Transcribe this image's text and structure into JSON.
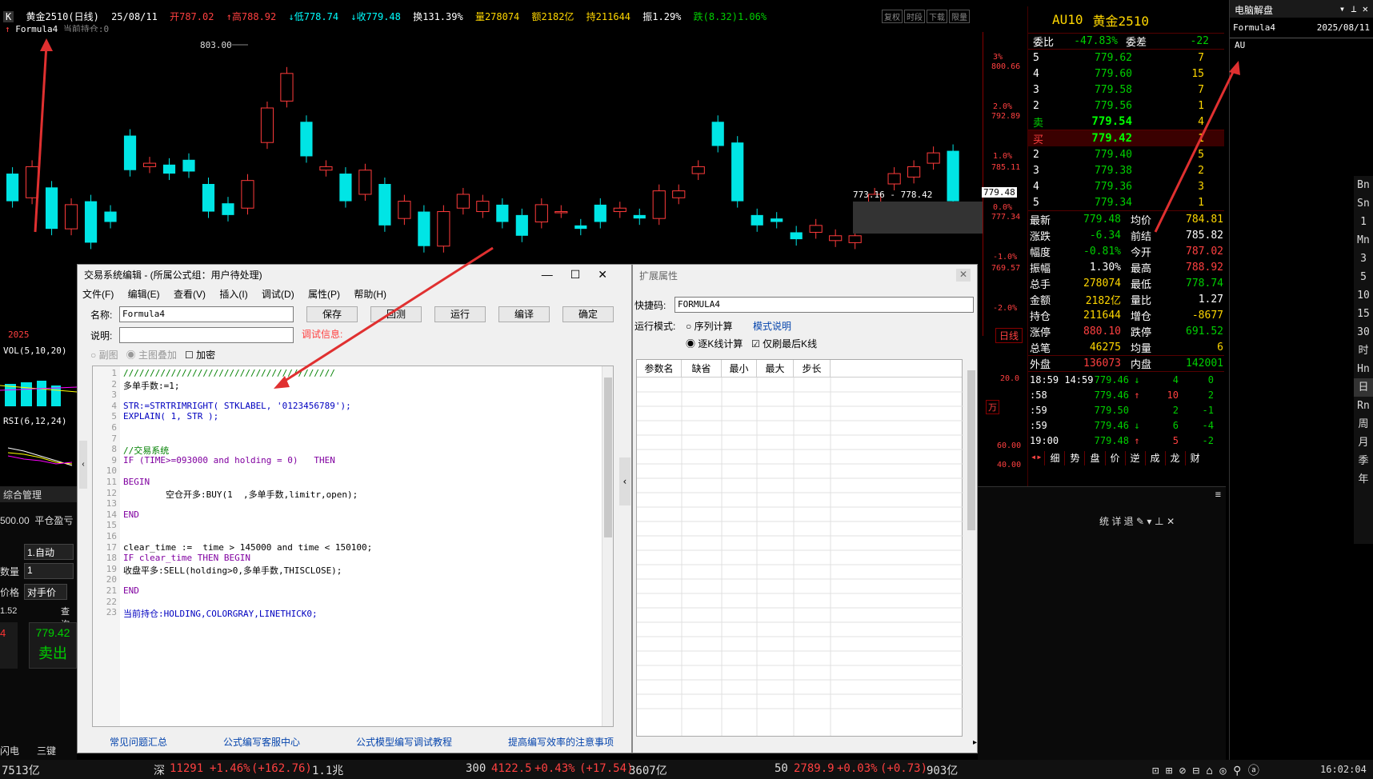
{
  "topbar": {
    "icon_label": "K",
    "symbol": "黄金2510(日线)",
    "date": "25/08/11",
    "open": "开787.02",
    "high": "↑高788.92",
    "low": "↓低778.74",
    "close": "↓收779.48",
    "turnover": "换131.39%",
    "volume": "量278074",
    "amount": "额2182亿",
    "hold": "持211644",
    "amplitude": "振1.29%",
    "change": "跌(8.32)1.06%",
    "buttons": [
      "复权",
      "时段",
      "下载",
      "限量"
    ],
    "formula": "Formula4",
    "position": "当前持仓:0"
  },
  "chart": {
    "peak_label": "803.00",
    "range_label": "773.16 - 778.42",
    "price_tag": "779.48",
    "axis_right": [
      "800.66",
      "792.89",
      "785.11",
      "777.34",
      "769.57"
    ],
    "pct_axis": [
      "3%",
      "2.0%",
      "1.0%",
      "0.0%",
      "-1.0%",
      "-2.0%"
    ],
    "year": "2025",
    "vol_label": "VOL(5,10,20)",
    "rsi_label": "RSI(6,12,24)",
    "rsi_axis": [
      "20.0",
      "60.00",
      "40.00"
    ],
    "week_tab": "日线",
    "month_tab": "万",
    "candles": [
      {
        "o": 785.5,
        "c": 781.5
      },
      {
        "o": 782,
        "c": 786.5
      },
      {
        "o": 783.5,
        "c": 777.5
      },
      {
        "o": 777.5,
        "c": 781.0
      },
      {
        "o": 781.5,
        "c": 775.5
      },
      {
        "o": 780.0,
        "c": 778.5
      },
      {
        "o": 791.0,
        "c": 786.0
      },
      {
        "o": 786.5,
        "c": 787.0
      },
      {
        "o": 786.8,
        "c": 785.5
      },
      {
        "o": 787.5,
        "c": 785.8
      },
      {
        "o": 784.0,
        "c": 780.0
      },
      {
        "o": 781.2,
        "c": 779.5
      },
      {
        "o": 780.5,
        "c": 784.5
      },
      {
        "o": 790.0,
        "c": 795.0
      },
      {
        "o": 796.0,
        "c": 800.0
      },
      {
        "o": 793.0,
        "c": 788.0
      },
      {
        "o": 786.0,
        "c": 786.5
      },
      {
        "o": 785.5,
        "c": 781.5
      },
      {
        "o": 782.5,
        "c": 786.0
      },
      {
        "o": 784.0,
        "c": 778.0
      },
      {
        "o": 779.0,
        "c": 781.5
      },
      {
        "o": 780.0,
        "c": 775.0
      },
      {
        "o": 775.0,
        "c": 780.0
      },
      {
        "o": 780.5,
        "c": 782.5
      },
      {
        "o": 780.0,
        "c": 781.5
      },
      {
        "o": 781.0,
        "c": 778.5
      },
      {
        "o": 779.5,
        "c": 776.5
      },
      {
        "o": 778.5,
        "c": 781.0
      },
      {
        "o": 780.0,
        "c": 780.0
      },
      {
        "o": 778.0,
        "c": 777.5
      },
      {
        "o": 781.0,
        "c": 778.5
      },
      {
        "o": 780.0,
        "c": 780.5
      },
      {
        "o": 779.5,
        "c": 779.0
      },
      {
        "o": 779.0,
        "c": 783.0
      },
      {
        "o": 782.0,
        "c": 783.0
      },
      {
        "o": 785.5,
        "c": 786.5
      },
      {
        "o": 793.0,
        "c": 789.5
      },
      {
        "o": 790.0,
        "c": 781.5
      },
      {
        "o": 779.5,
        "c": 778.0
      },
      {
        "o": 779.0,
        "c": 778.5
      },
      {
        "o": 777.0,
        "c": 776.0
      },
      {
        "o": 777.0,
        "c": 778.0
      },
      {
        "o": 775.8,
        "c": 776.5
      },
      {
        "o": 775.5,
        "c": 776.5
      },
      {
        "o": 780.0,
        "c": 782.5
      },
      {
        "o": 784.0,
        "c": 785.5
      },
      {
        "o": 785.0,
        "c": 786.5
      },
      {
        "o": 787.0,
        "c": 788.5
      },
      {
        "o": 788.8,
        "c": 781.5
      }
    ]
  },
  "rpanel": {
    "code": "AU10",
    "name": "黄金2510",
    "weibi_label": "委比",
    "weibi": "-47.83%",
    "weicha_label": "委差",
    "weicha": "-22",
    "asks": [
      {
        "lvl": "5",
        "px": "779.62",
        "qty": "7"
      },
      {
        "lvl": "4",
        "px": "779.60",
        "qty": "15"
      },
      {
        "lvl": "3",
        "px": "779.58",
        "qty": "7"
      },
      {
        "lvl": "2",
        "px": "779.56",
        "qty": "1"
      },
      {
        "lvl": "卖",
        "px": "779.54",
        "qty": "4"
      }
    ],
    "bids": [
      {
        "lvl": "买",
        "px": "779.42",
        "qty": "1"
      },
      {
        "lvl": "2",
        "px": "779.40",
        "qty": "5"
      },
      {
        "lvl": "3",
        "px": "779.38",
        "qty": "2"
      },
      {
        "lvl": "4",
        "px": "779.36",
        "qty": "3"
      },
      {
        "lvl": "5",
        "px": "779.34",
        "qty": "1"
      }
    ],
    "stats": [
      {
        "l": "最新",
        "v": "779.48",
        "vc": "grn",
        "l2": "均价",
        "v2": "784.81",
        "v2c": "yel"
      },
      {
        "l": "涨跌",
        "v": "-6.34",
        "vc": "grn",
        "l2": "前结",
        "v2": "785.82",
        "v2c": "wht"
      },
      {
        "l": "幅度",
        "v": "-0.81%",
        "vc": "grn",
        "l2": "今开",
        "v2": "787.02",
        "v2c": "red"
      },
      {
        "l": "振幅",
        "v": "1.30%",
        "vc": "wht",
        "l2": "最高",
        "v2": "788.92",
        "v2c": "red"
      },
      {
        "l": "总手",
        "v": "278074",
        "vc": "yel",
        "l2": "最低",
        "v2": "778.74",
        "v2c": "grn"
      },
      {
        "l": "金额",
        "v": "2182亿",
        "vc": "yel",
        "l2": "量比",
        "v2": "1.27",
        "v2c": "wht"
      },
      {
        "l": "持仓",
        "v": "211644",
        "vc": "yel",
        "l2": "增仓",
        "v2": "-8677",
        "v2c": "yel"
      },
      {
        "l": "涨停",
        "v": "880.10",
        "vc": "red",
        "l2": "跌停",
        "v2": "691.52",
        "v2c": "grn"
      },
      {
        "l": "总笔",
        "v": "46275",
        "vc": "yel",
        "l2": "均量",
        "v2": "6",
        "v2c": "yel"
      }
    ],
    "outer_label": "外盘",
    "outer": "136073",
    "inner_label": "内盘",
    "inner": "142001",
    "ticks": [
      {
        "t": "18:59 14:59",
        "px": "779.46",
        "dir": "↓",
        "q": "4",
        "d": "0"
      },
      {
        "t": ":58",
        "px": "779.46",
        "dir": "↑",
        "q": "10",
        "d": "2"
      },
      {
        "t": ":59",
        "px": "779.50",
        "dir": "",
        "q": "2",
        "d": "-1"
      },
      {
        "t": ":59",
        "px": "779.46",
        "dir": "↓",
        "q": "6",
        "d": "-4"
      },
      {
        "t": "19:00",
        "px": "779.48",
        "dir": "↑",
        "q": "5",
        "d": "-2"
      }
    ],
    "tabs": [
      "细",
      "势",
      "盘",
      "价",
      "逆",
      "成",
      "龙",
      "财"
    ]
  },
  "side": {
    "title": "电脑解盘",
    "formula": "Formula4",
    "date": "2025/08/11",
    "content": "AU"
  },
  "sidebar": [
    "Bn",
    "Sn",
    "1",
    "Mn",
    "3",
    "5",
    "10",
    "15",
    "30",
    "时",
    "Hn",
    "日",
    "Rn",
    "周",
    "月",
    "季",
    "年"
  ],
  "lpanel": {
    "tab": "综合管理",
    "price": "500.00",
    "pnl_label": "平仓盈亏",
    "mode": "1.自动",
    "qty_label": "数量",
    "qty": "1",
    "price_label": "价格",
    "price_mode": "对手价",
    "query": "查询",
    "last": "1.52",
    "sell_price": "779.42",
    "sell_label": "卖出",
    "left_num": "4",
    "flash": "闪电",
    "three": "三键"
  },
  "editor": {
    "title": "交易系统编辑 - (所属公式组：用户待处理)",
    "menu": [
      "文件(F)",
      "编辑(E)",
      "查看(V)",
      "插入(I)",
      "调试(D)",
      "属性(P)",
      "帮助(H)"
    ],
    "name_label": "名称:",
    "name_value": "Formula4",
    "desc_label": "说明:",
    "debug_label": "调试信息:",
    "buttons": [
      "保存",
      "回测",
      "运行",
      "编译",
      "确定"
    ],
    "opt_sub": "副图",
    "opt_main": "主图叠加",
    "opt_encrypt": "加密",
    "lines": [
      "////////////////////////////////////////",
      "多单手数:=1;",
      "",
      "STR:=STRTRIMRIGHT( STKLABEL, '0123456789');",
      "EXPLAIN( 1, STR );",
      "",
      "",
      "//交易系统",
      "IF (TIME>=093000 and holding = 0)   THEN",
      "",
      "BEGIN",
      "        空仓开多:BUY(1  ,多单手数,limitr,open);",
      "",
      "END",
      "",
      "",
      "clear_time :=  time > 145000 and time < 150100;",
      "IF clear_time THEN BEGIN",
      "收盘平多:SELL(holding>0,多单手数,THISCLOSE);",
      "",
      "END",
      "",
      "当前持仓:HOLDING,COLORGRAY,LINETHICK0;"
    ],
    "links": [
      "常见问题汇总",
      "公式编写客服中心",
      "公式模型编写调试教程",
      "提高编写效率的注意事项"
    ]
  },
  "ext": {
    "title": "扩展属性",
    "shortcut_label": "快捷码:",
    "shortcut": "FORMULA4",
    "mode_label": "运行模式:",
    "mode1": "序列计算",
    "mode2": "逐K线计算",
    "mode_help": "模式说明",
    "only_last": "仅刷最后K线",
    "cols": [
      "参数名",
      "缺省",
      "最小",
      "最大",
      "步长"
    ]
  },
  "bottom": {
    "a": "7513亿",
    "b_label": "深",
    "b_val": "11291",
    "b_chg": "+1.46%",
    "b_chg2": "(+162.76)",
    "b_amt": "1.1兆",
    "c_label": "300",
    "c_val": "4122.5",
    "c_chg": "+0.43%",
    "c_chg2": "(+17.54)",
    "c_amt": "3607亿",
    "d_label": "50",
    "d_val": "2789.9",
    "d_chg": "+0.03%",
    "d_chg2": "(+0.73)",
    "d_amt": "903亿",
    "time": "16:02:04"
  }
}
